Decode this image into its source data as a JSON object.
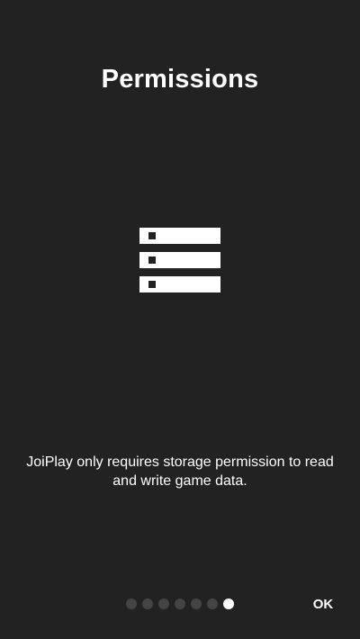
{
  "screen": {
    "title": "Permissions",
    "illustration_icon": "storage-icon",
    "description": "JoiPlay only requires storage permission to read and write game data."
  },
  "pager": {
    "total_pages": 7,
    "current_page": 7
  },
  "footer": {
    "ok_label": "OK"
  },
  "colors": {
    "background": "#222222",
    "text": "#ffffff",
    "inactive_dot": "#444444",
    "active_dot": "#ffffff"
  }
}
